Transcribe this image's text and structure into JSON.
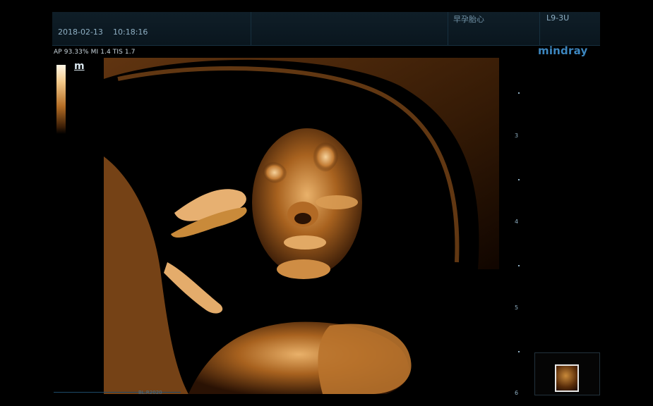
{
  "header": {
    "date": "2018-02-13",
    "time": "10:18:16",
    "exam": "早孕胎心",
    "probe": "L9-3U"
  },
  "params_line": "AP 93.33%  MI 1.4 TIS 1.7",
  "brand": "mindray",
  "grayscale_label": "m",
  "depth_scale": [
    "3",
    "4",
    "5",
    "6"
  ],
  "bottom_text": "BL.R2020",
  "colors": {
    "header_bg": "#0f1e28",
    "brand": "#3c86bf",
    "image_tint": "#c98a3a"
  },
  "icons": {
    "thumbnail": "image-thumbnail-icon"
  }
}
